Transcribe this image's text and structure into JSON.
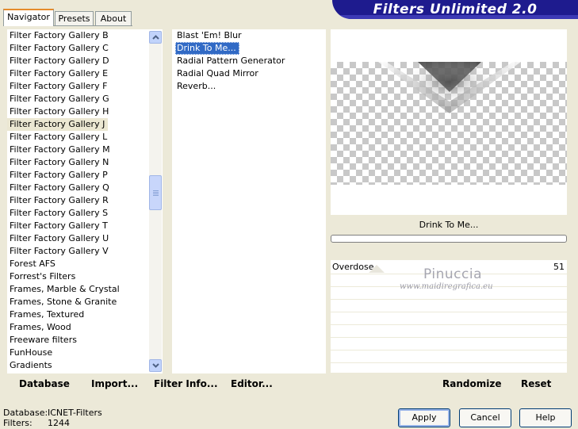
{
  "tabs": [
    {
      "label": "Navigator",
      "active": true
    },
    {
      "label": "Presets",
      "active": false
    },
    {
      "label": "About",
      "active": false
    }
  ],
  "banner": {
    "title": "Filters Unlimited 2.0",
    "color": "#1e1b8e"
  },
  "categories": [
    "Filter Factory Gallery B",
    "Filter Factory Gallery C",
    "Filter Factory Gallery D",
    "Filter Factory Gallery E",
    "Filter Factory Gallery F",
    "Filter Factory Gallery G",
    "Filter Factory Gallery H",
    "Filter Factory Gallery J",
    "Filter Factory Gallery L",
    "Filter Factory Gallery M",
    "Filter Factory Gallery N",
    "Filter Factory Gallery P",
    "Filter Factory Gallery Q",
    "Filter Factory Gallery R",
    "Filter Factory Gallery S",
    "Filter Factory Gallery T",
    "Filter Factory Gallery U",
    "Filter Factory Gallery V",
    "Forest AFS",
    "Forrest's Filters",
    "Frames, Marble & Crystal",
    "Frames, Stone & Granite",
    "Frames, Textured",
    "Frames, Wood",
    "Freeware filters",
    "FunHouse",
    "Gradients"
  ],
  "selected_category": "Filter Factory Gallery J",
  "filters": [
    "Blast 'Em! Blur",
    "Drink To Me...",
    "Radial Pattern Generator",
    "Radial Quad Mirror",
    "Reverb..."
  ],
  "selected_filter": "Drink To Me...",
  "preview": {
    "filter_name": "Drink To Me..."
  },
  "parameters": [
    {
      "label": "Overdose",
      "value": "51"
    }
  ],
  "watermark": {
    "name": "Pinuccia",
    "url": "www.maidiregrafica.eu"
  },
  "bottom_bar": {
    "database": "Database",
    "import": "Import...",
    "filter_info": "Filter Info...",
    "editor": "Editor...",
    "randomize": "Randomize",
    "reset": "Reset"
  },
  "status": {
    "database_label": "Database:",
    "database_value": "ICNET-Filters",
    "filters_label": "Filters:",
    "filters_value": "1244"
  },
  "dialog_buttons": {
    "apply": "Apply",
    "cancel": "Cancel",
    "help": "Help"
  },
  "icons": {
    "scroll_up": "chevron-up-icon",
    "scroll_down": "chevron-down-icon"
  }
}
